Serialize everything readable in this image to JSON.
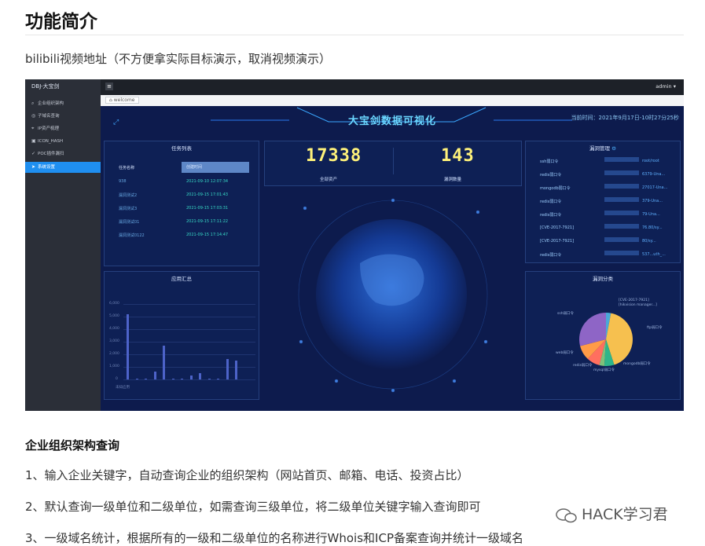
{
  "title": "功能简介",
  "intro": "bilibili视频地址（不方便拿实际目标演示，取消视频演示）",
  "screenshot": {
    "logo": "DBJ-大宝剑",
    "sidebar": [
      {
        "label": "企业组织架构",
        "icon": "search-icon"
      },
      {
        "label": "子域名查询",
        "icon": "globe-icon"
      },
      {
        "label": "IP资产梳理",
        "icon": "pin-icon"
      },
      {
        "label": "ICON_HASH",
        "icon": "image-icon"
      },
      {
        "label": "POC插件漏扫",
        "icon": "check-icon"
      },
      {
        "label": "系统设置",
        "icon": "send-icon"
      }
    ],
    "admin": "admin ▾",
    "tab": "welcome",
    "dashboard": {
      "title": "大宝剑数据可视化",
      "time": "当前时间：2021年9月17日-10时27分25秒",
      "task_panel": {
        "title": "任务列表",
        "headers": [
          "任务名称",
          "创建时间"
        ],
        "rows": [
          [
            "938",
            "2021-09-10 12:07:34"
          ],
          [
            "漏洞测试2",
            "2021-09-15 17:01:43"
          ],
          [
            "漏洞测试3",
            "2021-09-15 17:03:31"
          ],
          [
            "漏洞测试01",
            "2021-09-15 17:11:22"
          ],
          [
            "漏洞测试0122",
            "2021-09-15 17:14:47"
          ]
        ]
      },
      "stats": [
        {
          "value": "17338",
          "label": "全部资产"
        },
        {
          "value": "143",
          "label": "漏洞数量"
        }
      ],
      "leak_panel": {
        "title": "漏洞管理",
        "rows": [
          [
            "ssh弱口令",
            "root/root"
          ],
          [
            "redis弱口令",
            "6379-Una..."
          ],
          [
            "mongodb弱口令",
            "27017-Una..."
          ],
          [
            "redis弱口令",
            "379-Una..."
          ],
          [
            "redis弱口令",
            "79-Una..."
          ],
          [
            "[CVE-2017-7921]",
            "76.80/sy..."
          ],
          [
            "[CVE-2017-7921]",
            "80/sy..."
          ],
          [
            "redis弱口令",
            "537...uth_..."
          ]
        ]
      },
      "app_panel": {
        "title": "应用汇总",
        "y_ticks": [
          "6,000",
          "5,000",
          "4,000",
          "3,000",
          "2,000",
          "1,000",
          "0"
        ],
        "x_label": "未知应用"
      },
      "pie_panel": {
        "title": "漏洞分类",
        "labels": [
          "[CVE-2017-7921]",
          "[hikvision manager...]",
          "ssh弱口令",
          "ftp弱口令",
          "web弱口令",
          "redis弱口令",
          "mongodb弱口令",
          "mysql弱口令"
        ]
      }
    }
  },
  "section": {
    "heading": "企业组织架构查询",
    "items": [
      "1、输入企业关键字，自动查询企业的组织架构（网站首页、邮箱、电话、投资占比）",
      "2、默认查询一级单位和二级单位，如需查询三级单位，将二级单位关键字输入查询即可",
      "3、一级域名统计，根据所有的一级和二级单位的名称进行Whois和ICP备案查询并统计一级域名"
    ]
  },
  "watermark": "HACK学习君",
  "chart_data": [
    {
      "type": "bar",
      "title": "应用汇总",
      "categories": [
        "未知应用"
      ],
      "ylim": [
        0,
        6000
      ],
      "y_ticks": [
        0,
        1000,
        2000,
        3000,
        4000,
        5000,
        6000
      ],
      "values": [
        5200,
        30,
        30,
        600,
        2700,
        40,
        60,
        300,
        500,
        20,
        30,
        1600,
        1500
      ],
      "grid": true
    },
    {
      "type": "pie",
      "title": "漏洞分类",
      "categories": [
        "[CVE-2017-7921]",
        "ftp弱口令",
        "mongodb弱口令",
        "mysql弱口令",
        "redis弱口令",
        "web弱口令",
        "ssh弱口令"
      ],
      "values": [
        3,
        42,
        6,
        3,
        8,
        9,
        29
      ],
      "colors": [
        "#4aa8d8",
        "#f6c04f",
        "#2fb58a",
        "#7fc17a",
        "#ff6f5f",
        "#ff9b47",
        "#8e65c6"
      ]
    }
  ]
}
